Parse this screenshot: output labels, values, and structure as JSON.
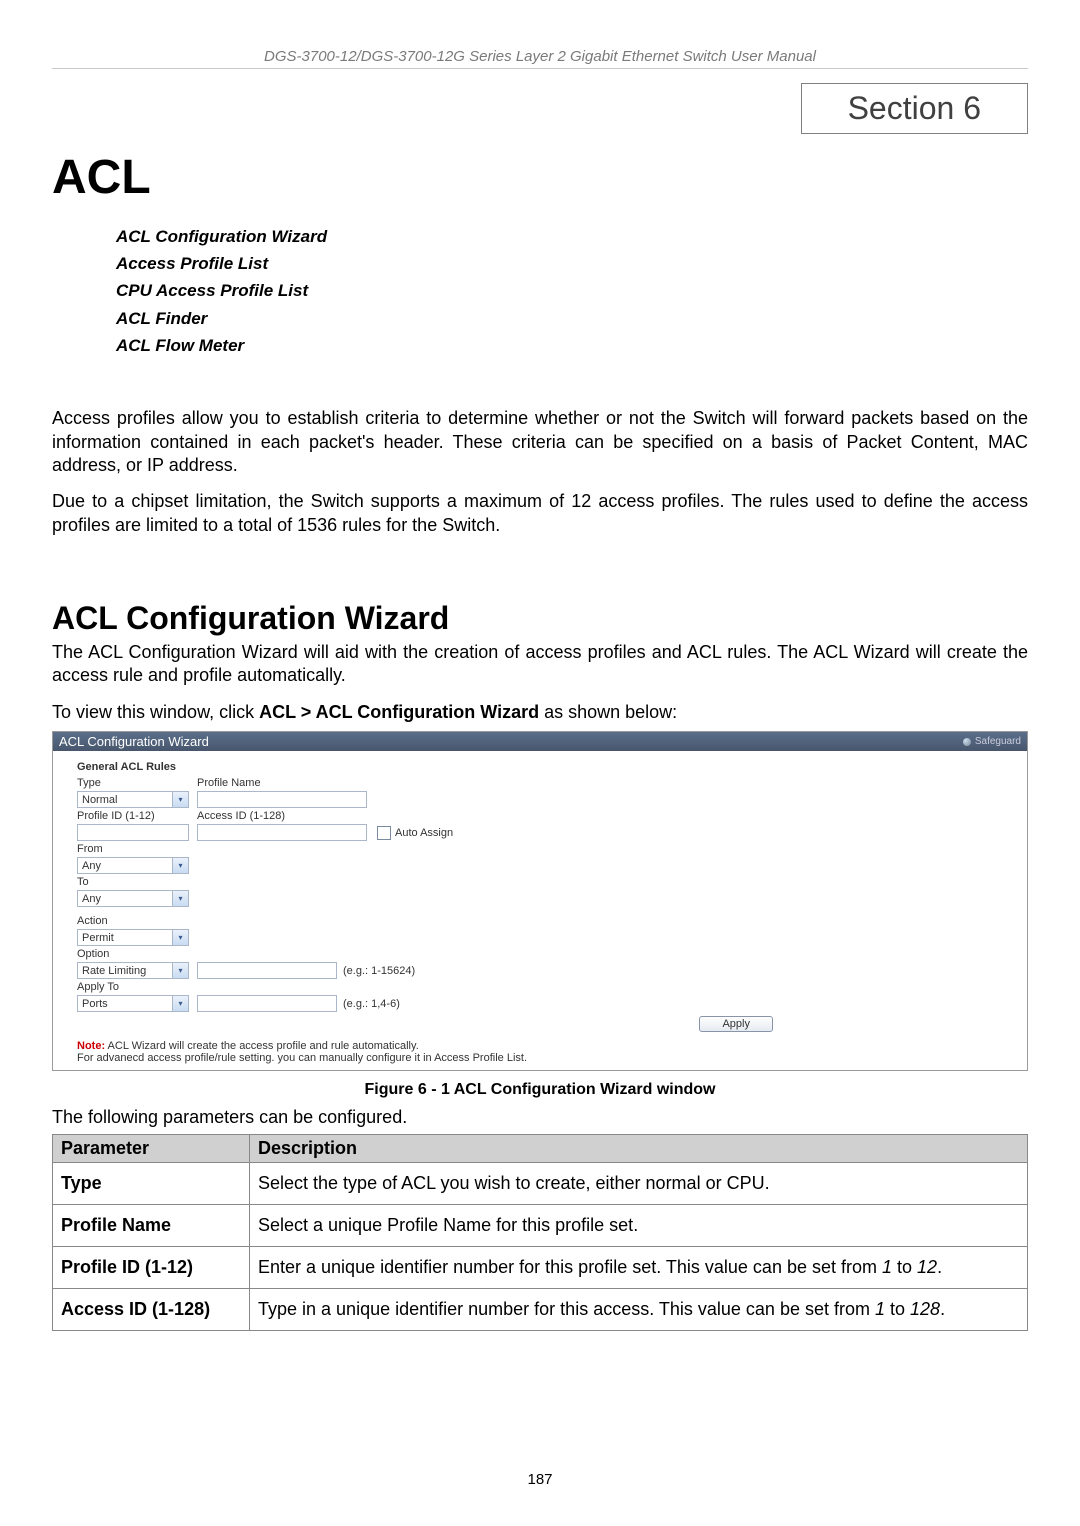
{
  "header": "DGS-3700-12/DGS-3700-12G Series Layer 2 Gigabit Ethernet Switch User Manual",
  "section_box": "Section 6",
  "h1": "ACL",
  "toc": [
    "ACL Configuration Wizard",
    "Access Profile List",
    "CPU Access Profile List",
    "ACL Finder",
    "ACL Flow Meter"
  ],
  "para1": "Access profiles allow you to establish criteria to determine whether or not the Switch will forward packets based on the information contained in each packet's header. These criteria can be specified on a basis of Packet Content, MAC address, or IP address.",
  "para2": "Due to a chipset limitation, the Switch supports a maximum of 12 access profiles. The rules used to define the access profiles are limited to a total of 1536 rules for the Switch.",
  "h2": "ACL Configuration Wizard",
  "para3": "The ACL Configuration Wizard will aid with the creation of access profiles and ACL rules. The ACL Wizard will create the access rule and profile automatically.",
  "nav_pre": "To view this window, click ",
  "nav_bold": "ACL > ACL Configuration Wizard",
  "nav_post": " as shown below:",
  "shot": {
    "title": "ACL Configuration Wizard",
    "safeguard": "Safeguard",
    "group": "General ACL Rules",
    "labels": {
      "type": "Type",
      "profile_name": "Profile Name",
      "profile_id": "Profile ID (1-12)",
      "access_id": "Access ID (1-128)",
      "auto_assign": "Auto Assign",
      "from": "From",
      "to": "To",
      "action": "Action",
      "option": "Option",
      "apply_to": "Apply To"
    },
    "values": {
      "type": "Normal",
      "from": "Any",
      "to": "Any",
      "action": "Permit",
      "option": "Rate Limiting",
      "option_hint": "(e.g.: 1-15624)",
      "apply_to": "Ports",
      "apply_hint": "(e.g.: 1,4-6)"
    },
    "apply_btn": "Apply",
    "note_label": "Note:",
    "note_line1": " ACL Wizard will create the access profile and rule automatically.",
    "note_line2": "For advanecd access profile/rule setting. you can manually configure it in Access Profile List."
  },
  "fig_caption": "Figure 6 - 1 ACL Configuration Wizard window",
  "table_intro": "The following parameters can be configured.",
  "table_headers": {
    "param": "Parameter",
    "desc": "Description"
  },
  "table_rows": [
    {
      "p": "Type",
      "d_pre": "Select the type of ACL you wish to create, either normal or CPU.",
      "d_i1": "",
      "d_mid": "",
      "d_i2": "",
      "d_post": ""
    },
    {
      "p": "Profile Name",
      "d_pre": "Select a unique Profile Name for this profile set.",
      "d_i1": "",
      "d_mid": "",
      "d_i2": "",
      "d_post": ""
    },
    {
      "p": "Profile ID (1-12)",
      "d_pre": "Enter a unique identifier number for this profile set. This value can be set from ",
      "d_i1": "1",
      "d_mid": " to ",
      "d_i2": "12",
      "d_post": "."
    },
    {
      "p": "Access ID (1-128)",
      "d_pre": "Type in a unique identifier number for this access. This value can be set from ",
      "d_i1": "1",
      "d_mid": " to ",
      "d_i2": "128",
      "d_post": "."
    }
  ],
  "page_number": "187"
}
